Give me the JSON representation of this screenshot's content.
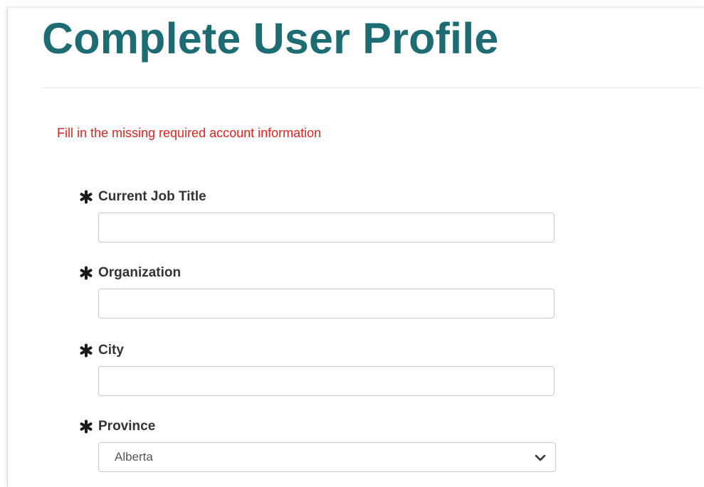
{
  "page": {
    "title": "Complete User Profile",
    "alert": "Fill in the missing required account information"
  },
  "form": {
    "required_marker_icon": "asterisk-icon",
    "fields": [
      {
        "label": "Current Job Title",
        "value": "",
        "placeholder": ""
      },
      {
        "label": "Organization",
        "value": "",
        "placeholder": ""
      },
      {
        "label": "City",
        "value": "",
        "placeholder": ""
      },
      {
        "label": "Province",
        "selected": "Alberta",
        "dropdown_icon": "chevron-down-icon"
      }
    ]
  },
  "colors": {
    "title": "#1e6c73",
    "alert": "#e0241c",
    "label": "#333333",
    "input_border": "#c8c8c8"
  }
}
